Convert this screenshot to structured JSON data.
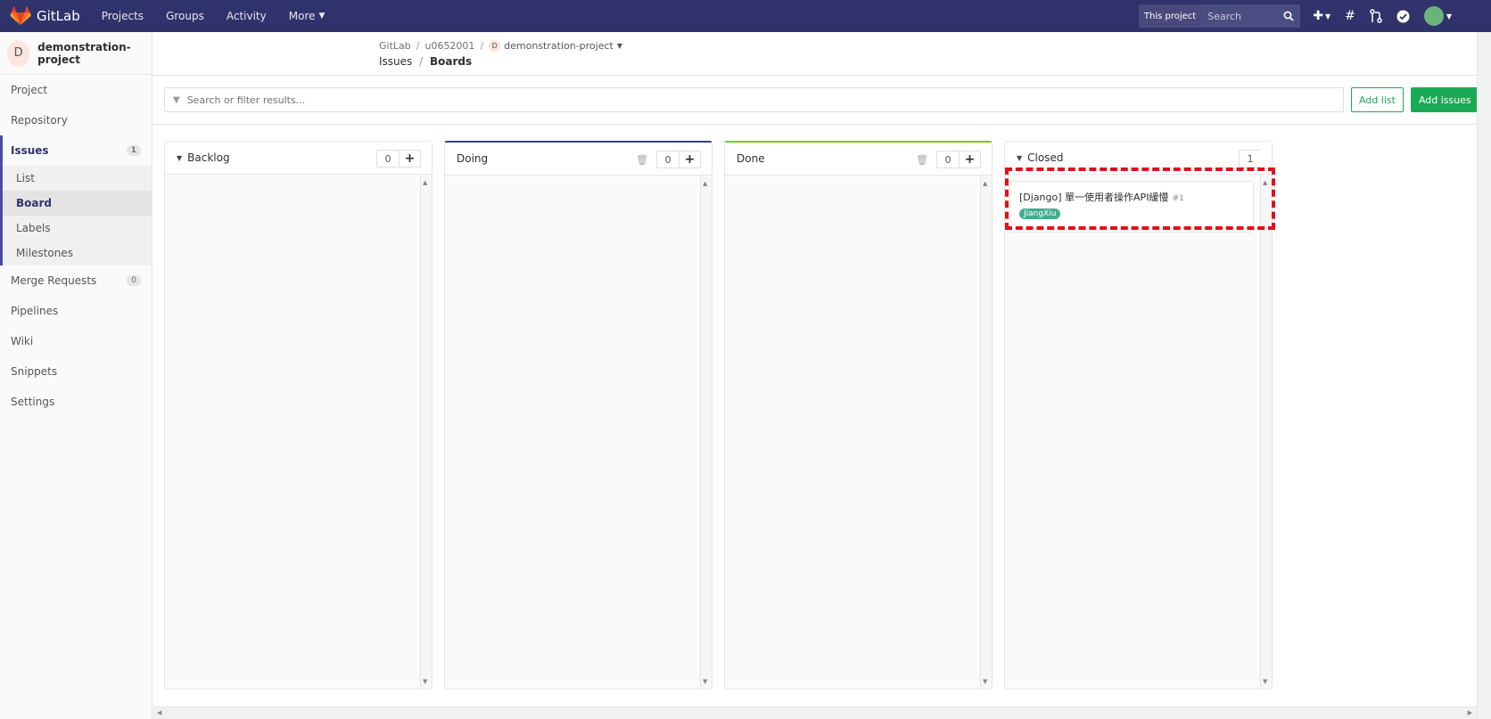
{
  "navbar": {
    "brand": "GitLab",
    "links": [
      "Projects",
      "Groups",
      "Activity",
      "More"
    ],
    "scope_label": "This project",
    "search_placeholder": "Search",
    "colors": {
      "bg": "#30336b"
    }
  },
  "sidebar": {
    "project_initial": "D",
    "project_name": "demonstration-project",
    "items": [
      {
        "label": "Project"
      },
      {
        "label": "Repository"
      },
      {
        "label": "Issues",
        "count": "1"
      }
    ],
    "issues_sub": [
      "List",
      "Board",
      "Labels",
      "Milestones"
    ],
    "items_after": [
      {
        "label": "Merge Requests",
        "count": "0"
      },
      {
        "label": "Pipelines"
      },
      {
        "label": "Wiki"
      },
      {
        "label": "Snippets"
      },
      {
        "label": "Settings"
      }
    ]
  },
  "breadcrumb": {
    "root": "GitLab",
    "user": "u0652001",
    "project_initial": "D",
    "project": "demonstration-project",
    "section": "Issues",
    "page": "Boards"
  },
  "filter": {
    "placeholder": "Search or filter results...",
    "add_list": "Add list",
    "add_issues": "Add issues"
  },
  "boards": [
    {
      "title": "Backlog",
      "count": "0"
    },
    {
      "title": "Doing",
      "count": "0",
      "accent": "#2e3a9e"
    },
    {
      "title": "Done",
      "count": "0",
      "accent": "#69d100"
    },
    {
      "title": "Closed",
      "count": "1"
    }
  ],
  "closed_card": {
    "title": "[Django] 單一使用者操作API緩慢",
    "number": "#1",
    "label": "JiangXiu",
    "label_color": "#44ad8e"
  }
}
